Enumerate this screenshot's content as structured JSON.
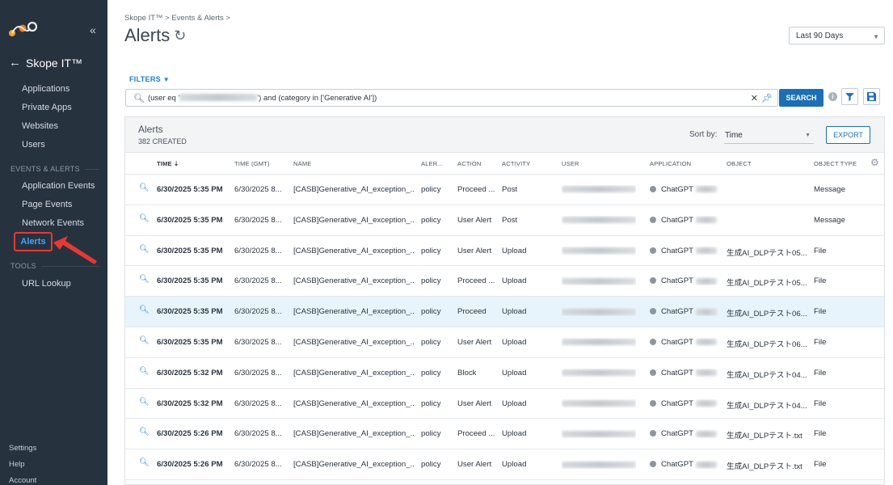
{
  "sidebar": {
    "product_title": "Skope IT™",
    "items_top": [
      "Applications",
      "Private Apps",
      "Websites",
      "Users"
    ],
    "section_events": "EVENTS & ALERTS",
    "items_events": [
      "Application Events",
      "Page Events",
      "Network Events"
    ],
    "active_item": "Alerts",
    "section_tools": "TOOLS",
    "items_tools": [
      "URL Lookup"
    ],
    "bottom": [
      "Settings",
      "Help",
      "Account"
    ]
  },
  "header": {
    "breadcrumb": "Skope IT™ > Events & Alerts >",
    "title": "Alerts",
    "time_range": "Last 90 Days"
  },
  "filters": {
    "label": "FILTERS",
    "query_prefix": "(user eq '",
    "query_suffix": "') and (category in ['Generative AI'])",
    "search_label": "SEARCH"
  },
  "panel": {
    "title": "Alerts",
    "subtitle": "382 CREATED",
    "sort_label": "Sort by:",
    "sort_value": "Time",
    "export_label": "EXPORT"
  },
  "columns": {
    "time": "TIME",
    "time_gmt": "TIME (GMT)",
    "name": "NAME",
    "alert_type": "ALER...",
    "action": "ACTION",
    "activity": "ACTIVITY",
    "user": "USER",
    "application": "APPLICATION",
    "object": "OBJECT",
    "object_type": "OBJECT TYPE"
  },
  "rows": [
    {
      "time": "6/30/2025 5:35 PM",
      "gmt": "6/30/2025 8...",
      "name": "[CASB]Generative_AI_exception_...",
      "type": "policy",
      "action": "Proceed ...",
      "activity": "Post",
      "app": "ChatGPT",
      "object": "",
      "object_type": "Message"
    },
    {
      "time": "6/30/2025 5:35 PM",
      "gmt": "6/30/2025 8...",
      "name": "[CASB]Generative_AI_exception_...",
      "type": "policy",
      "action": "User Alert",
      "activity": "Post",
      "app": "ChatGPT",
      "object": "",
      "object_type": "Message"
    },
    {
      "time": "6/30/2025 5:35 PM",
      "gmt": "6/30/2025 8...",
      "name": "[CASB]Generative_AI_exception_...",
      "type": "policy",
      "action": "User Alert",
      "activity": "Upload",
      "app": "ChatGPT",
      "object": "生成AI_DLPテスト05....",
      "object_type": "File"
    },
    {
      "time": "6/30/2025 5:35 PM",
      "gmt": "6/30/2025 8...",
      "name": "[CASB]Generative_AI_exception_...",
      "type": "policy",
      "action": "Proceed ...",
      "activity": "Upload",
      "app": "ChatGPT",
      "object": "生成AI_DLPテスト05....",
      "object_type": "File"
    },
    {
      "time": "6/30/2025 5:35 PM",
      "gmt": "6/30/2025 8...",
      "name": "[CASB]Generative_AI_exception_...",
      "type": "policy",
      "action": "Proceed",
      "activity": "Upload",
      "app": "ChatGPT",
      "object": "生成AI_DLPテスト06....",
      "object_type": "File"
    },
    {
      "time": "6/30/2025 5:35 PM",
      "gmt": "6/30/2025 8...",
      "name": "[CASB]Generative_AI_exception_...",
      "type": "policy",
      "action": "User Alert",
      "activity": "Upload",
      "app": "ChatGPT",
      "object": "生成AI_DLPテスト06....",
      "object_type": "File"
    },
    {
      "time": "6/30/2025 5:32 PM",
      "gmt": "6/30/2025 8...",
      "name": "[CASB]Generative_AI_exception_...",
      "type": "policy",
      "action": "Block",
      "activity": "Upload",
      "app": "ChatGPT",
      "object": "生成AI_DLPテスト04....",
      "object_type": "File"
    },
    {
      "time": "6/30/2025 5:32 PM",
      "gmt": "6/30/2025 8...",
      "name": "[CASB]Generative_AI_exception_...",
      "type": "policy",
      "action": "User Alert",
      "activity": "Upload",
      "app": "ChatGPT",
      "object": "生成AI_DLPテスト04....",
      "object_type": "File"
    },
    {
      "time": "6/30/2025 5:26 PM",
      "gmt": "6/30/2025 8...",
      "name": "[CASB]Generative_AI_exception_...",
      "type": "policy",
      "action": "Proceed ...",
      "activity": "Upload",
      "app": "ChatGPT",
      "object": "生成AI_DLPテスト.txt",
      "object_type": "File"
    },
    {
      "time": "6/30/2025 5:26 PM",
      "gmt": "6/30/2025 8...",
      "name": "[CASB]Generative_AI_exception_...",
      "type": "policy",
      "action": "User Alert",
      "activity": "Upload",
      "app": "ChatGPT",
      "object": "生成AI_DLPテスト.txt",
      "object_type": "File"
    }
  ],
  "icons": [
    "logo-icon",
    "collapse-icon",
    "back-arrow-icon",
    "refresh-icon",
    "filter-caret-icon",
    "search-icon",
    "clear-icon",
    "pin-icon",
    "info-icon",
    "funnel-icon",
    "save-icon",
    "sort-desc-icon",
    "settings-gear-icon",
    "zoom-in-icon",
    "chatgpt-icon",
    "red-arrow-annotation"
  ],
  "colors": {
    "sidebar_bg": "#27323f",
    "accent": "#1c6fb4",
    "active_link": "#41a4ff",
    "highlight_row": "#e8f4fb",
    "annotation_red": "#e53935"
  }
}
